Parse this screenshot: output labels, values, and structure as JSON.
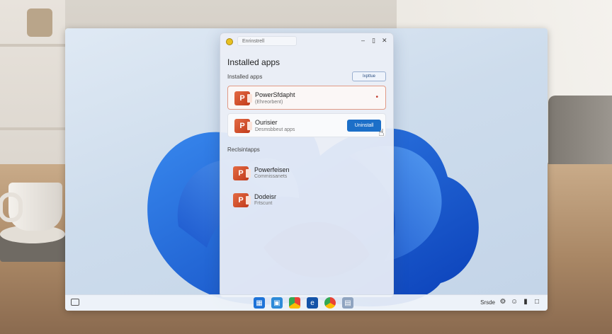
{
  "window": {
    "search_text": "Enrinstrell",
    "title": "Installed apps",
    "section_installed": "Installed apps",
    "sort_button": "Ixpttue",
    "section_recommended": "Reclsintapps",
    "more_icon": "ellipsis-icon",
    "uninstall_button": "Uninstall",
    "selected_apps": [
      {
        "name": "PowerSfdapht",
        "sub": "(Ehreorbent)"
      },
      {
        "name": "Ourisier",
        "sub": "Desmsbbeut apps"
      }
    ],
    "recommended_apps": [
      {
        "name": "Powerfeisen",
        "sub": "Commissanets"
      },
      {
        "name": "Dodeisr",
        "sub": "Frtscunt"
      }
    ]
  },
  "taskbar": {
    "tray_text": "Srsde"
  },
  "colors": {
    "accent": "#1c6fc8",
    "powerpoint": "#d24726",
    "selection_border": "#e09a86"
  }
}
